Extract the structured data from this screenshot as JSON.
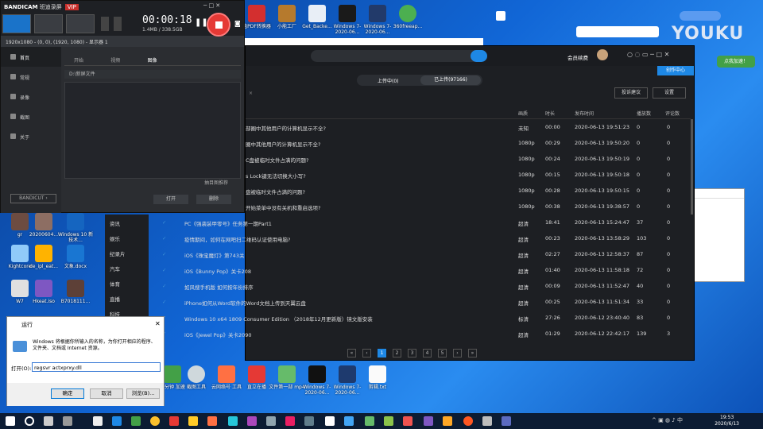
{
  "bandicam": {
    "brand": "BANDICAM",
    "brand_sub": "班迪录屏",
    "vip": "VIP",
    "timer": "00:00:18",
    "size": "1.4MB / 338.5GB",
    "info": "1920x1080 - (0, 0), (1920, 1080) - 显示器 1",
    "sidebar": [
      {
        "label": "首页"
      },
      {
        "label": "常规"
      },
      {
        "label": "录像"
      },
      {
        "label": "截图"
      },
      {
        "label": "关于"
      }
    ],
    "tabs": [
      {
        "label": "开始"
      },
      {
        "label": "视频"
      },
      {
        "label": "图像"
      }
    ],
    "path": "D:\\新屏文件",
    "folder_btn": "抽目图推荐",
    "open": "打开",
    "delete": "删除",
    "logo": "BANDICUT ›"
  },
  "app": {
    "seg_left": "上传中(0)",
    "seg_right": "已上传(97166)",
    "feedback": "投诉建议",
    "settings": "设置",
    "member": "会员续费",
    "center": "创作中心",
    "columns": {
      "quality": "画质",
      "duration": "时长",
      "time": "发布时间",
      "plays": "播放数",
      "comments": "评论数"
    },
    "rows": [
      {
        "title": "部圈中其他用户的计算机显示不全?",
        "q": "未知",
        "d": "00:00",
        "t": "2020-06-13 19:51:23",
        "p": "0",
        "c": "0"
      },
      {
        "title": "圈中其他用户的计算机显示不全?",
        "q": "1080p",
        "d": "00:29",
        "t": "2020-06-13 19:50:20",
        "p": "0",
        "c": "0"
      },
      {
        "title": "C盘被临时文件占满的问题?",
        "q": "1080p",
        "d": "00:24",
        "t": "2020-06-13 19:50:19",
        "p": "0",
        "c": "0"
      },
      {
        "title": "s Lock键无法切换大小写?",
        "q": "1080p",
        "d": "00:15",
        "t": "2020-06-13 19:50:18",
        "p": "0",
        "c": "0"
      },
      {
        "title": "盘被临时文件占满的问题?",
        "q": "1080p",
        "d": "00:28",
        "t": "2020-06-13 19:50:15",
        "p": "0",
        "c": "0"
      },
      {
        "title": "开始菜单中没有关机和重启选项?",
        "q": "1080p",
        "d": "00:38",
        "t": "2020-06-13 19:38:57",
        "p": "0",
        "c": "0"
      },
      {
        "title": "PC《强袭装甲零号》任务第一期Part1",
        "q": "超清",
        "d": "18:41",
        "t": "2020-06-13 15:24:47",
        "p": "37",
        "c": "0"
      },
      {
        "title": "疫情期间，如何在网吧扫二维码认证使用电脑?",
        "q": "超清",
        "d": "00:23",
        "t": "2020-06-13 13:58:29",
        "p": "103",
        "c": "0"
      },
      {
        "title": "iOS《珠宝魔灯》第743关",
        "q": "超清",
        "d": "02:27",
        "t": "2020-06-13 12:58:37",
        "p": "87",
        "c": "0"
      },
      {
        "title": "iOS《Bunny Pop》关卡208",
        "q": "超清",
        "d": "01:40",
        "t": "2020-06-13 11:58:18",
        "p": "72",
        "c": "0"
      },
      {
        "title": "如风搜手机版 如何按年份排序",
        "q": "超清",
        "d": "00:09",
        "t": "2020-06-13 11:52:47",
        "p": "40",
        "c": "0"
      },
      {
        "title": "iPhone如何从Word软件的Word文档上传到天翼云盘",
        "q": "超清",
        "d": "00:25",
        "t": "2020-06-13 11:51:34",
        "p": "33",
        "c": "0"
      },
      {
        "title": "Windows 10 x64 1809 Consumer Edition （2018年12月更新版）镜文版安装",
        "q": "标清",
        "d": "27:26",
        "t": "2020-06-12 23:40:40",
        "p": "83",
        "c": "0"
      },
      {
        "title": "iOS《Jewel Pop》关卡2090",
        "q": "超清",
        "d": "01:29",
        "t": "2020-06-12 22:42:17",
        "p": "139",
        "c": "3"
      }
    ],
    "pages": [
      "«",
      "‹",
      "1",
      "2",
      "3",
      "4",
      "5",
      "›",
      "»"
    ],
    "categories": [
      "资讯",
      "娱乐",
      "纪录片",
      "汽车",
      "体育",
      "直播",
      "科技"
    ]
  },
  "run": {
    "title": "运行",
    "desc": "Windows 将根据你所输入的名称，为你打开相应的程序、文件夹、文档或 Internet 资源。",
    "open_label": "打开(O):",
    "value": "regsvr actxprxy.dll",
    "ok": "确定",
    "cancel": "取消",
    "browse": "浏览(B)..."
  },
  "desktop_top": [
    {
      "label": "电PDF转换器"
    },
    {
      "label": "小能工厂"
    },
    {
      "label": "Get_Backe..."
    },
    {
      "label": "Windows 7-2020-06..."
    },
    {
      "label": "Windows 7-2020-06..."
    },
    {
      "label": "360freeap..."
    }
  ],
  "desktop_left": [
    {
      "label": "gr"
    },
    {
      "label": "20200604..."
    },
    {
      "label": "Windows 10 新技术..."
    },
    {
      "label": "Kightcore"
    },
    {
      "label": "de_ipl_eat..."
    },
    {
      "label": "文象.docx"
    },
    {
      "label": "W7"
    },
    {
      "label": "Hkeat.iso"
    },
    {
      "label": "B7018111..."
    }
  ],
  "desktop_bottom": [
    {
      "label": "百分钟 加速"
    },
    {
      "label": "截图工具"
    },
    {
      "label": "云网络号 工具"
    },
    {
      "label": "直立在播"
    },
    {
      "label": "文件第一部 mp4"
    },
    {
      "label": "Windows 7-2020-06..."
    },
    {
      "label": "Windows 7-2020-06..."
    },
    {
      "label": "剪辑.txt"
    }
  ],
  "youku": {
    "logo": "YOUKU",
    "btn": "点我加速！"
  },
  "taskbar": {
    "time": "19:53",
    "date": "2020/6/13"
  }
}
